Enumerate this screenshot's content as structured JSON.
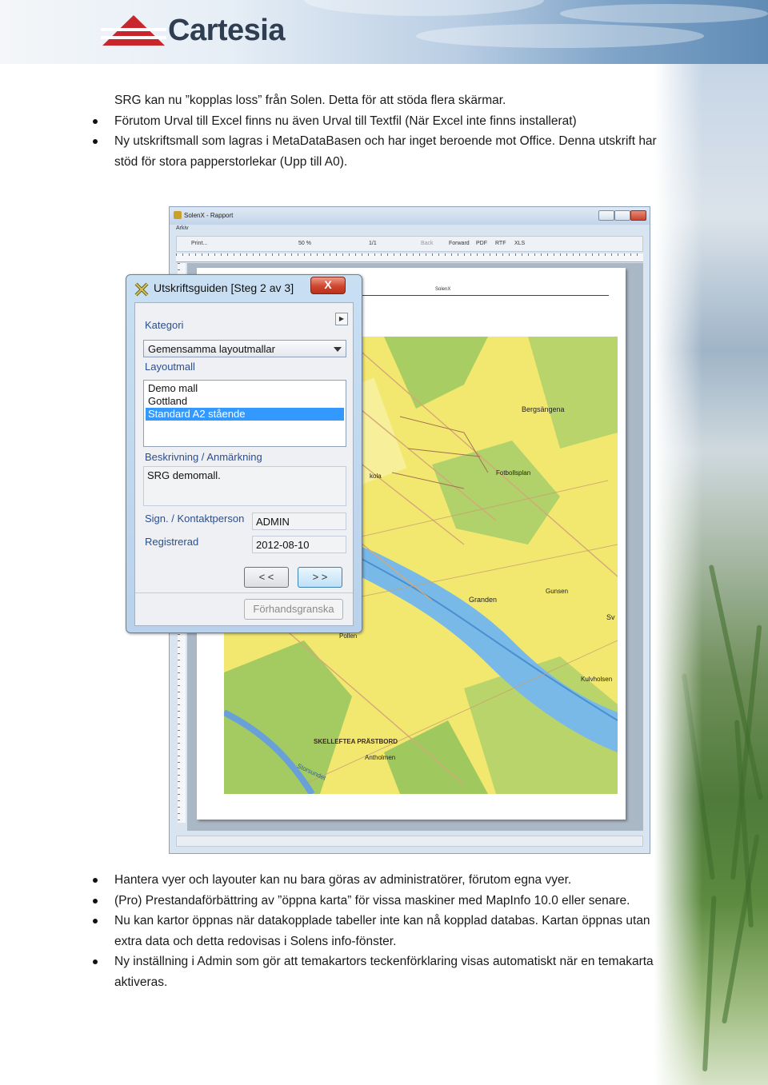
{
  "header": {
    "logo_text": "Cartesia"
  },
  "intro": {
    "lines": [
      "SRG kan nu ”kopplas loss” från Solen. Detta för att stöda flera skärmar."
    ],
    "bullets": [
      "Förutom Urval till Excel finns nu även Urval till Textfil (När Excel inte finns installerat)",
      "Ny utskriftsmall som lagras i MetaDataBasen och har inget beroende mot Office. Denna utskrift har stöd för stora papperstorlekar (Upp till A0)."
    ]
  },
  "screenshot": {
    "window_title": "SolenX - Rapport",
    "menu": "Arkiv",
    "toolbar": {
      "print": "Print...",
      "zoom": "50 %",
      "page": "1/1",
      "back": "Back",
      "forward": "Forward",
      "pdf": "PDF",
      "rtf": "RTF",
      "xls": "XLS"
    },
    "paper_header": "SolenX",
    "map_labels": {
      "bergsangena": "Bergsängena",
      "fotbollsplan": "Fotbollsplan",
      "kola": "kola",
      "granden": "Granden",
      "gunsen": "Gunsen",
      "sv": "Sv",
      "pollen": "Pollen",
      "kulvholsen": "Kulvholsen",
      "skelleftea": "SKELLEFTEA PRÄSTBORD",
      "antholmen": "Antholmen",
      "storsundet": "Storsundet"
    },
    "dialog": {
      "title": "Utskriftsguiden [Steg 2 av 3]",
      "close": "X",
      "kategori_label": "Kategori",
      "kategori_value": "Gemensamma layoutmallar",
      "layoutmall_label": "Layoutmall",
      "layouts": [
        "Demo mall",
        "Gottland",
        "Standard A2 stående"
      ],
      "selected_layout": "Standard A2 stående",
      "beskrivning_label": "Beskrivning / Anmärkning",
      "beskrivning_value": "SRG demomall.",
      "sign_label": "Sign. / Kontaktperson",
      "sign_value": "ADMIN",
      "registrerad_label": "Registrerad",
      "registrerad_value": "2012-08-10",
      "prev_button": "< <",
      "next_button": "> >",
      "preview_button": "Förhandsgranska"
    }
  },
  "outro": {
    "bullets": [
      "Hantera vyer och layouter kan nu bara göras av administratörer, förutom egna vyer.",
      "(Pro) Prestandaförbättring av ”öppna karta” för vissa maskiner med MapInfo 10.0 eller senare.",
      "Nu kan kartor öppnas när datakopplade tabeller inte kan nå kopplad databas. Kartan öppnas utan extra data och detta redovisas i Solens info-fönster.",
      "Ny inställning i Admin som gör att temakartors teckenförklaring visas automatiskt när en temakarta aktiveras."
    ]
  },
  "colors": {
    "selection": "#3399ff",
    "dialog_label": "#2a4f8f",
    "logo_red": "#c8262c",
    "logo_text": "#2f3e50"
  }
}
